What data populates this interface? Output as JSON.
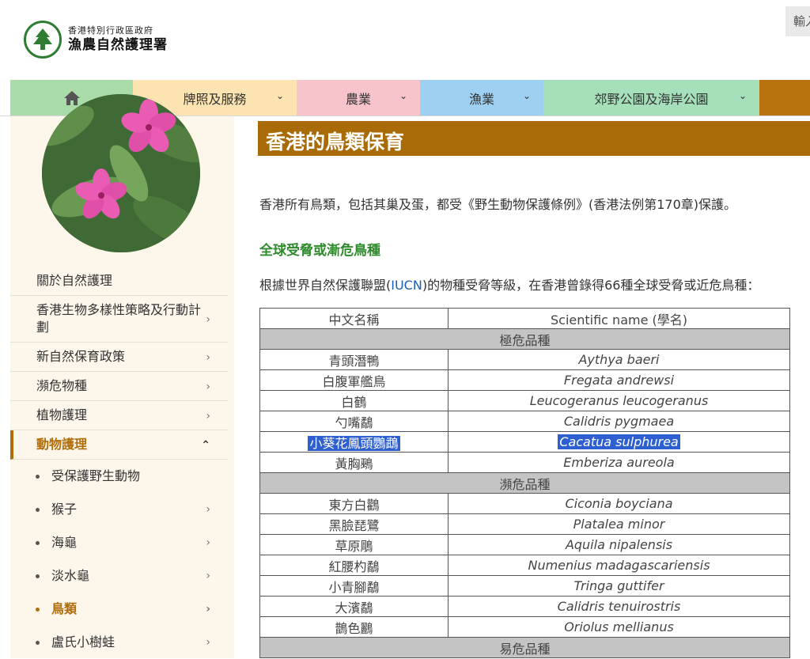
{
  "header": {
    "org_line1": "香港特別行政區政府",
    "org_line2": "漁農自然護理署",
    "search_placeholder": "輸入"
  },
  "nav": {
    "home_icon": "home-icon",
    "items": [
      "牌照及服務",
      "農業",
      "漁業",
      "郊野公園及海岸公園"
    ]
  },
  "sidebar": {
    "menu": [
      {
        "label": "關於自然護理",
        "chevron": false
      },
      {
        "label": "香港生物多樣性策略及行動計劃",
        "chevron": true
      },
      {
        "label": "新自然保育政策",
        "chevron": true
      },
      {
        "label": "瀕危物種",
        "chevron": true
      },
      {
        "label": "植物護理",
        "chevron": true
      },
      {
        "label": "動物護理",
        "chevron": true,
        "active": true
      }
    ],
    "submenu": [
      {
        "label": "受保護野生動物",
        "chevron": false
      },
      {
        "label": "猴子",
        "chevron": true
      },
      {
        "label": "海龜",
        "chevron": true
      },
      {
        "label": "淡水龜",
        "chevron": true
      },
      {
        "label": "鳥類",
        "chevron": true,
        "current": true
      },
      {
        "label": "盧氏小樹蛙",
        "chevron": true
      }
    ]
  },
  "main": {
    "title": "香港的鳥類保育",
    "intro": "香港所有鳥類，包括其巢及蛋，都受《野生動物保護條例》(香港法例第170章)保護。",
    "section_heading": "全球受脅或漸危鳥種",
    "para2_before": "根據世界自然保護聯盟(",
    "para2_link": "IUCN",
    "para2_after": ")的物種受脅等級，在香港曾錄得66種全球受脅或近危鳥種："
  },
  "table": {
    "headers": [
      "中文名稱",
      "Scientific name (學名)"
    ],
    "groups": [
      {
        "name": "極危品種",
        "rows": [
          {
            "zh": "青頭潛鴨",
            "sci": "Aythya baeri"
          },
          {
            "zh": "白腹軍艦鳥",
            "sci": "Fregata andrewsi"
          },
          {
            "zh": "白鶴",
            "sci": "Leucogeranus leucogeranus"
          },
          {
            "zh": "勺嘴鷸",
            "sci": "Calidris pygmaea"
          },
          {
            "zh": "小葵花鳳頭鸚鵡",
            "sci": "Cacatua sulphurea",
            "selected": true
          },
          {
            "zh": "黃胸鵐",
            "sci": "Emberiza aureola"
          }
        ]
      },
      {
        "name": "瀕危品種",
        "rows": [
          {
            "zh": "東方白鸛",
            "sci": "Ciconia boyciana"
          },
          {
            "zh": "黑臉琵鷺",
            "sci": "Platalea minor"
          },
          {
            "zh": "草原鵰",
            "sci": "Aquila nipalensis"
          },
          {
            "zh": "紅腰杓鷸",
            "sci": "Numenius madagascariensis"
          },
          {
            "zh": "小青腳鷸",
            "sci": "Tringa guttifer"
          },
          {
            "zh": "大濱鷸",
            "sci": "Calidris tenuirostris"
          },
          {
            "zh": "鵲色鸝",
            "sci": "Oriolus mellianus"
          }
        ]
      },
      {
        "name": "易危品種",
        "rows": []
      }
    ]
  },
  "colors": {
    "title_bg": "#a86b08",
    "heading_green": "#2f8a2b",
    "selection": "#2d5fd0"
  }
}
